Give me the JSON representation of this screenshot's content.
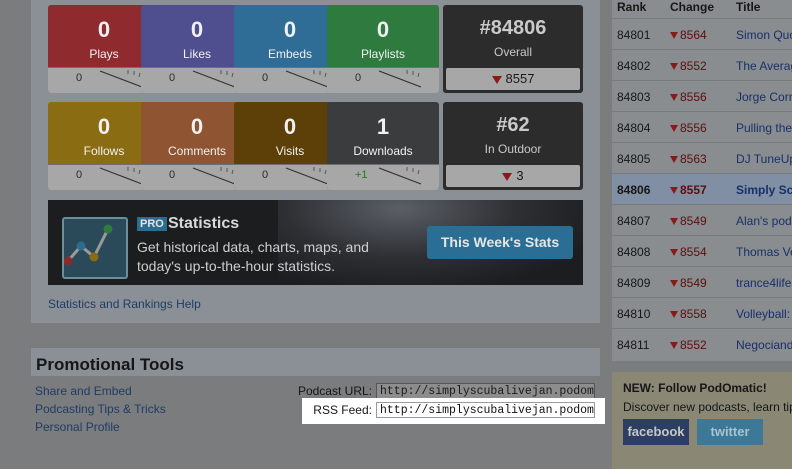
{
  "stats_tiles": [
    {
      "key": "plays",
      "value": "0",
      "label": "Plays",
      "gauge": "0",
      "color": "#8f2b2e"
    },
    {
      "key": "likes",
      "value": "0",
      "label": "Likes",
      "gauge": "0",
      "color": "#4f4e8f"
    },
    {
      "key": "embeds",
      "value": "0",
      "label": "Embeds",
      "gauge": "0",
      "color": "#2f6c96"
    },
    {
      "key": "playlists",
      "value": "0",
      "label": "Playlists",
      "gauge": "0",
      "color": "#2e7a3f"
    },
    {
      "key": "follows",
      "value": "0",
      "label": "Follows",
      "gauge": "0",
      "color": "#8a6c12"
    },
    {
      "key": "comments",
      "value": "0",
      "label": "Comments",
      "gauge": "0",
      "color": "#8f5431"
    },
    {
      "key": "visits",
      "value": "0",
      "label": "Visits",
      "gauge": "0",
      "color": "#5c4008"
    },
    {
      "key": "downloads",
      "value": "1",
      "label": "Downloads",
      "gauge": "+1",
      "color": "#3a3c3e"
    }
  ],
  "rank_overall": {
    "value": "#84806",
    "label": "Overall",
    "change": "8557"
  },
  "rank_category": {
    "value": "#62",
    "label": "In Outdoor",
    "change": "3"
  },
  "banner": {
    "badge": "PRO",
    "title": "Statistics",
    "description": "Get historical data, charts, maps, and today's up-to-the-hour statistics.",
    "button": "This Week's Stats"
  },
  "help_link": "Statistics and Rankings Help",
  "promo": {
    "heading": "Promotional Tools",
    "links": [
      "Share and Embed",
      "Podcasting Tips & Tricks",
      "Personal Profile"
    ],
    "podcast_url_label": "Podcast URL:",
    "podcast_url_value": "http://simplyscubalivejan.podomatic.com",
    "rss_label": "RSS Feed:",
    "rss_value": "http://simplyscubalivejan.podomatic.com"
  },
  "rank_table": {
    "headers": [
      "Rank",
      "Change",
      "Title"
    ],
    "rows": [
      {
        "rank": "84801",
        "change": "8564",
        "title": "Simon Quo"
      },
      {
        "rank": "84802",
        "change": "8552",
        "title": "The Averag"
      },
      {
        "rank": "84803",
        "change": "8556",
        "title": "Jorge Corr"
      },
      {
        "rank": "84804",
        "change": "8556",
        "title": "Pulling the"
      },
      {
        "rank": "84805",
        "change": "8563",
        "title": "DJ TuneUp"
      },
      {
        "rank": "84806",
        "change": "8557",
        "title": "Simply Sc",
        "current": true
      },
      {
        "rank": "84807",
        "change": "8549",
        "title": "Alan's pod"
      },
      {
        "rank": "84808",
        "change": "8554",
        "title": "Thomas Ve"
      },
      {
        "rank": "84809",
        "change": "8549",
        "title": "trance4life"
      },
      {
        "rank": "84810",
        "change": "8558",
        "title": "Volleyball:"
      },
      {
        "rank": "84811",
        "change": "8552",
        "title": "Negociand"
      }
    ]
  },
  "follow": {
    "title": "NEW: Follow PodOmatic!",
    "description": "Discover new podcasts, learn tip",
    "facebook": "facebook",
    "twitter": "twitter"
  }
}
